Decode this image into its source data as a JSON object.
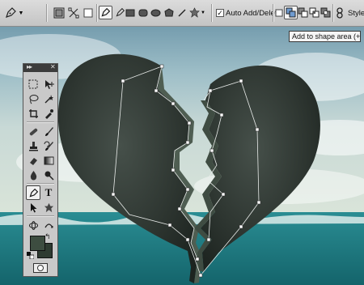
{
  "options_bar": {
    "auto_add_delete_label": "Auto Add/Delete",
    "auto_add_delete_checked": true,
    "style_label": "Style:"
  },
  "tooltip": {
    "text": "Add to shape area (+)"
  },
  "toolbox": {
    "collapse_glyph": "▸▸",
    "close_glyph": "✕",
    "swap_glyph": "↰"
  },
  "colors": {
    "foreground": "#3d4d40",
    "background": "#2e3b31",
    "sea": "#1f7f86",
    "heart_stone": "#2c342f",
    "path_anchor": "#ffffff"
  }
}
